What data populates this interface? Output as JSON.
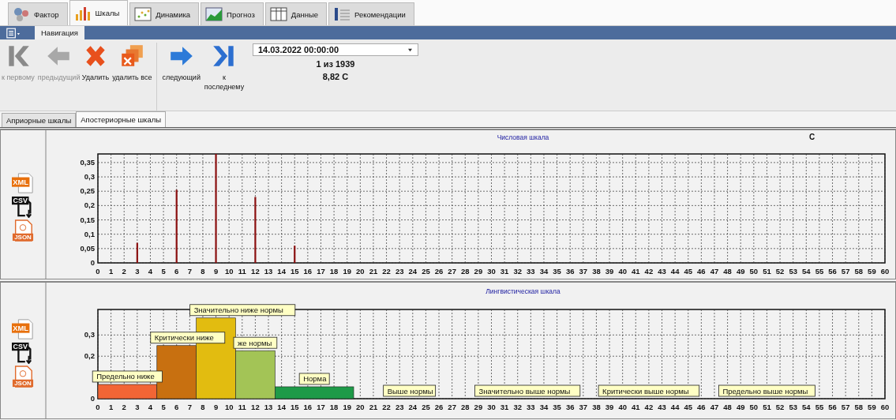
{
  "top_tabs": [
    {
      "label": "Фактор",
      "kind": "gears",
      "selected": false
    },
    {
      "label": "Шкалы",
      "kind": "bars",
      "selected": true
    },
    {
      "label": "Динамика",
      "kind": "scatter",
      "selected": false
    },
    {
      "label": "Прогноз",
      "kind": "line",
      "selected": false
    },
    {
      "label": "Данные",
      "kind": "table",
      "selected": false
    },
    {
      "label": "Рекомендации",
      "kind": "list",
      "selected": false
    }
  ],
  "ribbon": {
    "tabs": [
      {
        "label": "Навигация",
        "selected": true
      }
    ]
  },
  "toolbar": {
    "buttons": [
      {
        "label": "к первому",
        "kind": "first",
        "disabled": true
      },
      {
        "label": "предыдущий",
        "kind": "prev",
        "disabled": true
      },
      {
        "label": "Удалить",
        "kind": "delete",
        "disabled": false
      },
      {
        "label": "удалить все",
        "kind": "clear",
        "disabled": false
      },
      {
        "label": "следующий",
        "kind": "next",
        "disabled": false
      },
      {
        "label": "к последнему",
        "kind": "last",
        "disabled": false
      }
    ],
    "date": {
      "value": "14.03.2022 00:00:00"
    },
    "position": "1 из 1939",
    "reading": "8,82 С"
  },
  "scale_tabs": [
    {
      "label": "Априорные шкалы",
      "selected": false
    },
    {
      "label": "Апостериорные шкалы",
      "selected": true
    }
  ],
  "panels": [
    {
      "export_icons": [
        {
          "kind": "xml",
          "label": "XML"
        },
        {
          "kind": "csv",
          "label": "CSV"
        },
        {
          "kind": "json",
          "label": "JSON"
        }
      ],
      "chart_data": {
        "type": "bar",
        "title": "Числовая шкала",
        "xlabel": "С",
        "grid": true,
        "xlim": [
          0,
          60
        ],
        "ylim": [
          0,
          0.38
        ],
        "x": [
          3,
          6,
          9,
          12,
          15
        ],
        "series": [
          {
            "color": "#8b1010",
            "values": [
              0.07,
              0.255,
              0.38,
              0.23,
              0.06
            ]
          }
        ],
        "xticks": [
          0,
          1,
          2,
          3,
          4,
          5,
          6,
          7,
          8,
          9,
          10,
          11,
          12,
          13,
          14,
          15,
          16,
          17,
          18,
          19,
          20,
          21,
          22,
          23,
          24,
          25,
          26,
          27,
          28,
          29,
          30,
          31,
          32,
          33,
          34,
          35,
          36,
          37,
          38,
          39,
          40,
          41,
          42,
          43,
          44,
          45,
          46,
          47,
          48,
          49,
          50,
          51,
          52,
          53,
          54,
          55,
          56,
          57,
          58,
          59,
          60
        ],
        "yticks": [
          {
            "value": 0,
            "label": "0"
          },
          {
            "value": 0.05,
            "label": "0,05"
          },
          {
            "value": 0.1,
            "label": "0,1"
          },
          {
            "value": 0.15,
            "label": "0,15"
          },
          {
            "value": 0.2,
            "label": "0,2"
          },
          {
            "value": 0.25,
            "label": "0,25"
          },
          {
            "value": 0.3,
            "label": "0,3"
          },
          {
            "value": 0.35,
            "label": "0,35"
          }
        ]
      }
    },
    {
      "export_icons": [
        {
          "kind": "xml",
          "label": "XML"
        },
        {
          "kind": "csv",
          "label": "CSV"
        },
        {
          "kind": "json",
          "label": "JSON"
        }
      ],
      "chart_data": {
        "type": "bar",
        "title": "Лингвистическая шкала",
        "grid": true,
        "xlim": [
          0,
          60
        ],
        "ylim": [
          0,
          0.42
        ],
        "x": [
          2.25,
          6,
          9,
          12,
          16.5,
          23.75,
          32.75,
          42,
          51
        ],
        "series": [
          {
            "name": "Предельно ниже",
            "color": "#f26535",
            "values": [
              0.067,
              null,
              null,
              null,
              null,
              null,
              null,
              null,
              null
            ]
          },
          {
            "name": "Критически ниже",
            "color": "#c87010",
            "values": [
              null,
              0.25,
              null,
              null,
              null,
              null,
              null,
              null,
              null
            ]
          },
          {
            "name": "Значительно ниже нормы",
            "color": "#e2bc10",
            "values": [
              null,
              null,
              0.38,
              null,
              null,
              null,
              null,
              null,
              null
            ]
          },
          {
            "name": "же нормы",
            "color": "#a3c456",
            "values": [
              null,
              null,
              null,
              0.226,
              null,
              null,
              null,
              null,
              null
            ]
          },
          {
            "name": "Норма",
            "color": "#1e9a48",
            "values": [
              null,
              null,
              null,
              null,
              0.056,
              null,
              null,
              null,
              null
            ]
          },
          {
            "name": "Выше нормы",
            "values": [
              null,
              null,
              null,
              null,
              null,
              0,
              null,
              null,
              null
            ]
          },
          {
            "name": "Значительно выше нормы",
            "values": [
              null,
              null,
              null,
              null,
              null,
              null,
              0,
              null,
              null
            ]
          },
          {
            "name": "Критически выше нормы",
            "values": [
              null,
              null,
              null,
              null,
              null,
              null,
              null,
              0,
              null
            ]
          },
          {
            "name": "Предельно выше нормы",
            "values": [
              null,
              null,
              null,
              null,
              null,
              null,
              null,
              null,
              0
            ]
          }
        ],
        "xticks": [
          0,
          1,
          2,
          3,
          4,
          5,
          6,
          7,
          8,
          9,
          10,
          11,
          12,
          13,
          14,
          15,
          16,
          17,
          18,
          19,
          20,
          21,
          22,
          23,
          24,
          25,
          26,
          27,
          28,
          29,
          30,
          31,
          32,
          33,
          34,
          35,
          36,
          37,
          38,
          39,
          40,
          41,
          42,
          43,
          44,
          45,
          46,
          47,
          48,
          49,
          50,
          51,
          52,
          53,
          54,
          55,
          56,
          57,
          58,
          59,
          60
        ],
        "yticks": [
          {
            "value": 0,
            "label": "0"
          },
          {
            "value": 0.2,
            "label": "0,2"
          },
          {
            "value": 0.3,
            "label": "0,3"
          }
        ]
      }
    }
  ]
}
